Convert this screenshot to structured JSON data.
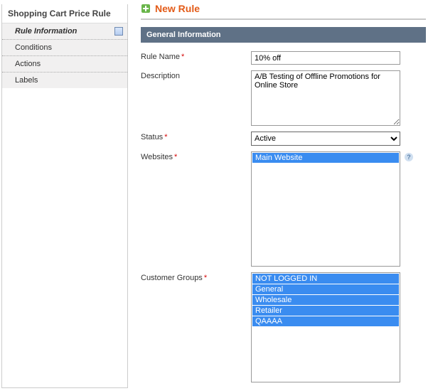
{
  "sidebar": {
    "title": "Shopping Cart Price Rule",
    "items": [
      {
        "label": "Rule Information"
      },
      {
        "label": "Conditions"
      },
      {
        "label": "Actions"
      },
      {
        "label": "Labels"
      }
    ]
  },
  "page": {
    "title": "New Rule"
  },
  "section": {
    "title": "General Information"
  },
  "form": {
    "rule_name_label": "Rule Name",
    "rule_name_value": "10% off",
    "description_label": "Description",
    "description_value": "A/B Testing of Offline Promotions for Online Store",
    "status_label": "Status",
    "status_value": "Active",
    "websites_label": "Websites",
    "websites_options": [
      "Main Website"
    ],
    "cgroups_label": "Customer Groups",
    "cgroups_options": [
      "NOT LOGGED IN",
      "General",
      "Wholesale",
      "Retailer",
      "QAAAA"
    ]
  },
  "icons": {
    "help": "?"
  }
}
